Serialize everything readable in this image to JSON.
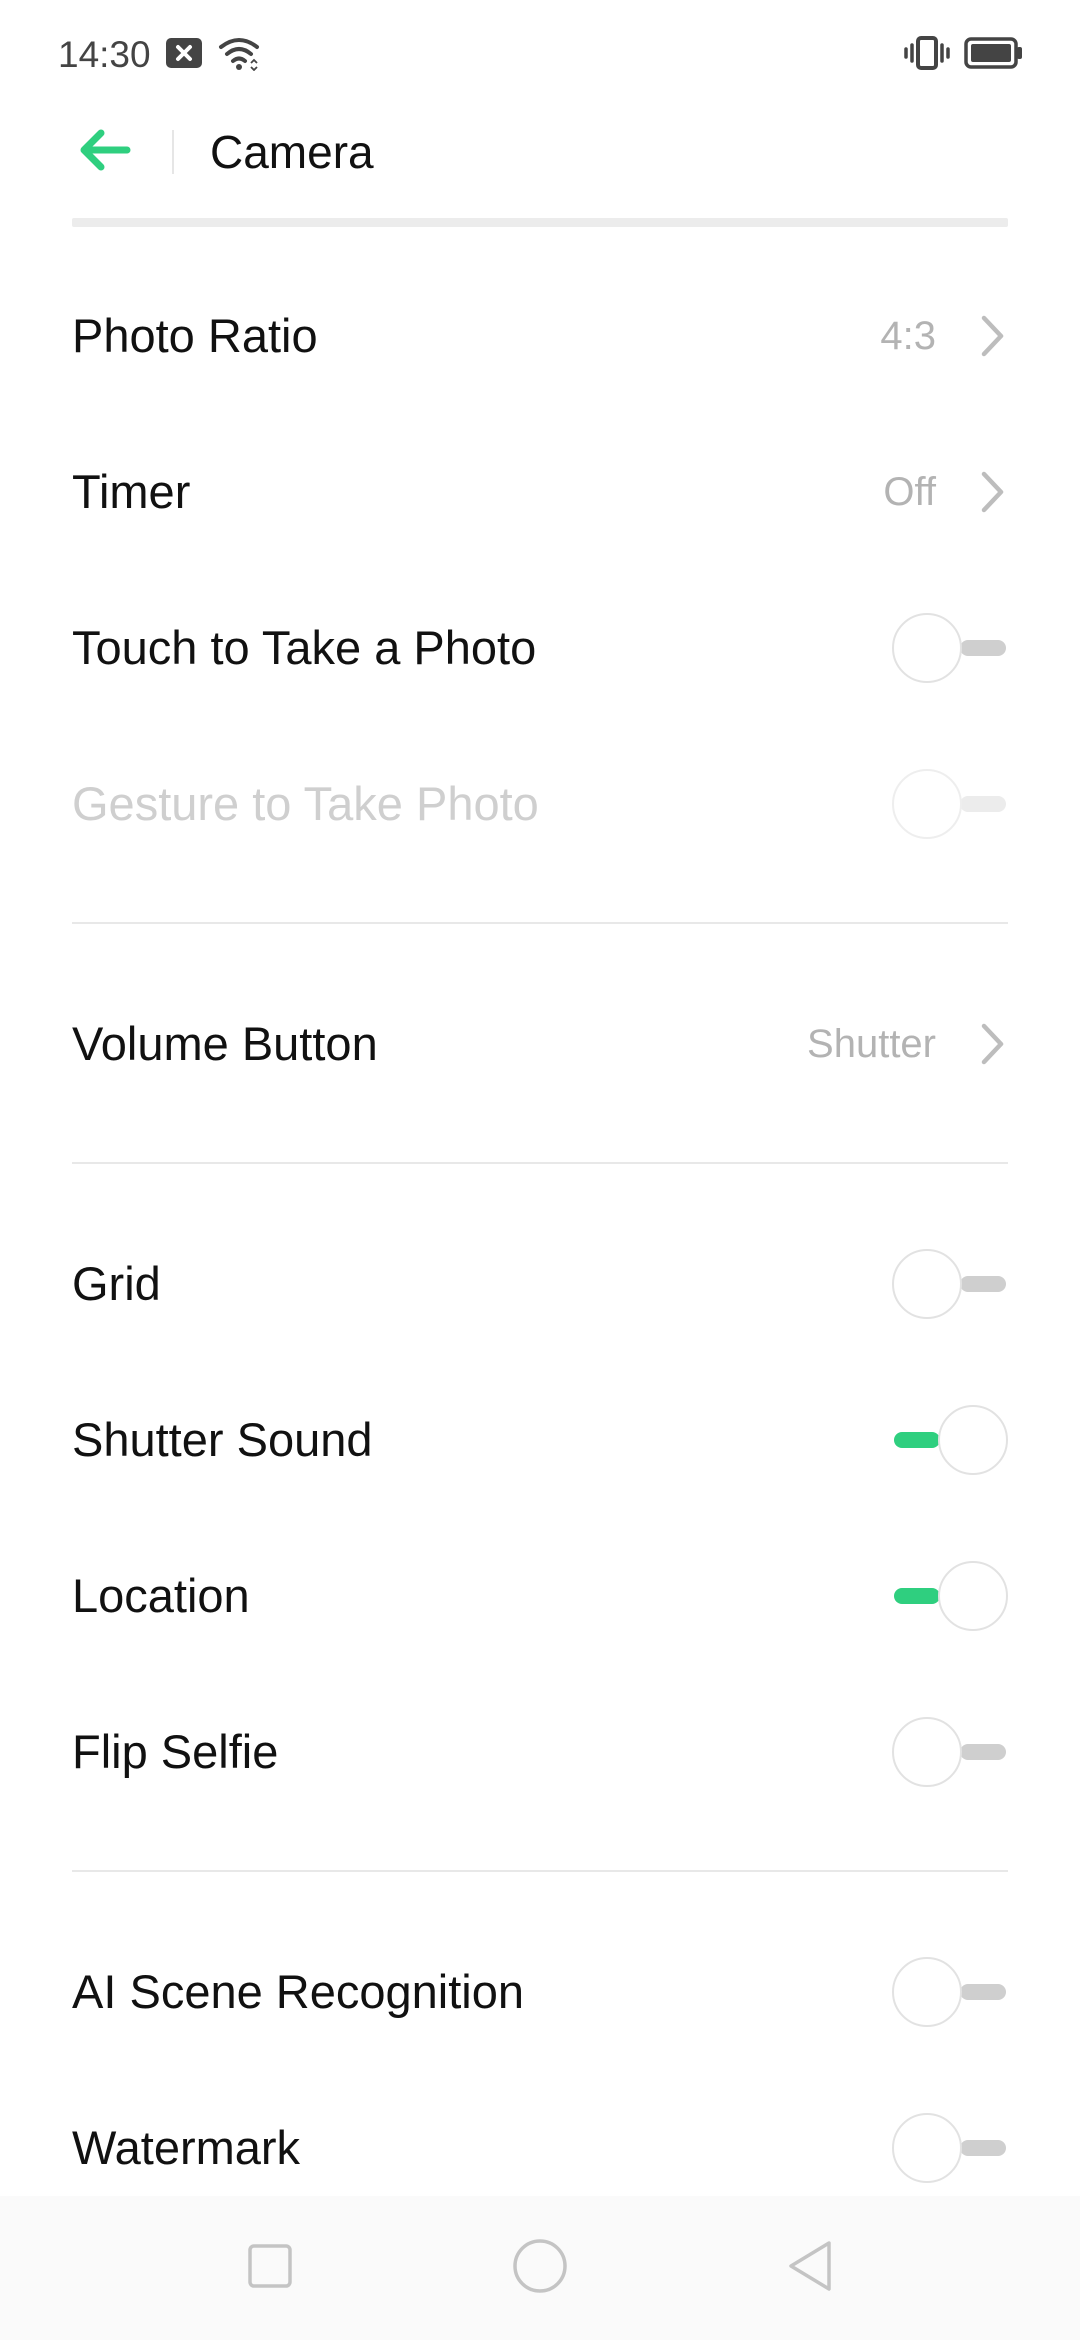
{
  "status_bar": {
    "time": "14:30",
    "icons": [
      "notification-close-icon",
      "wifi-icon",
      "vibrate-icon",
      "battery-icon"
    ]
  },
  "header": {
    "title": "Camera",
    "back_icon": "back-arrow-icon"
  },
  "colors": {
    "accent": "#2fcf7f",
    "toggle_off_track": "#cfcfcf",
    "secondary_text": "#b3b3b3",
    "disabled_text": "#cfcfcf"
  },
  "settings": {
    "photo_ratio": {
      "label": "Photo Ratio",
      "value": "4:3"
    },
    "timer": {
      "label": "Timer",
      "value": "Off"
    },
    "touch_to_take_photo": {
      "label": "Touch to Take a Photo",
      "enabled": false
    },
    "gesture_to_take_photo": {
      "label": "Gesture to Take Photo",
      "enabled": false,
      "disabled": true
    },
    "volume_button": {
      "label": "Volume Button",
      "value": "Shutter"
    },
    "grid": {
      "label": "Grid",
      "enabled": false
    },
    "shutter_sound": {
      "label": "Shutter Sound",
      "enabled": true
    },
    "location": {
      "label": "Location",
      "enabled": true
    },
    "flip_selfie": {
      "label": "Flip Selfie",
      "enabled": false
    },
    "ai_scene_recognition": {
      "label": "AI Scene Recognition",
      "enabled": false
    },
    "watermark": {
      "label": "Watermark",
      "enabled": false
    }
  },
  "nav_bar": {
    "buttons": [
      "recents-square-icon",
      "home-circle-icon",
      "back-triangle-icon"
    ]
  }
}
